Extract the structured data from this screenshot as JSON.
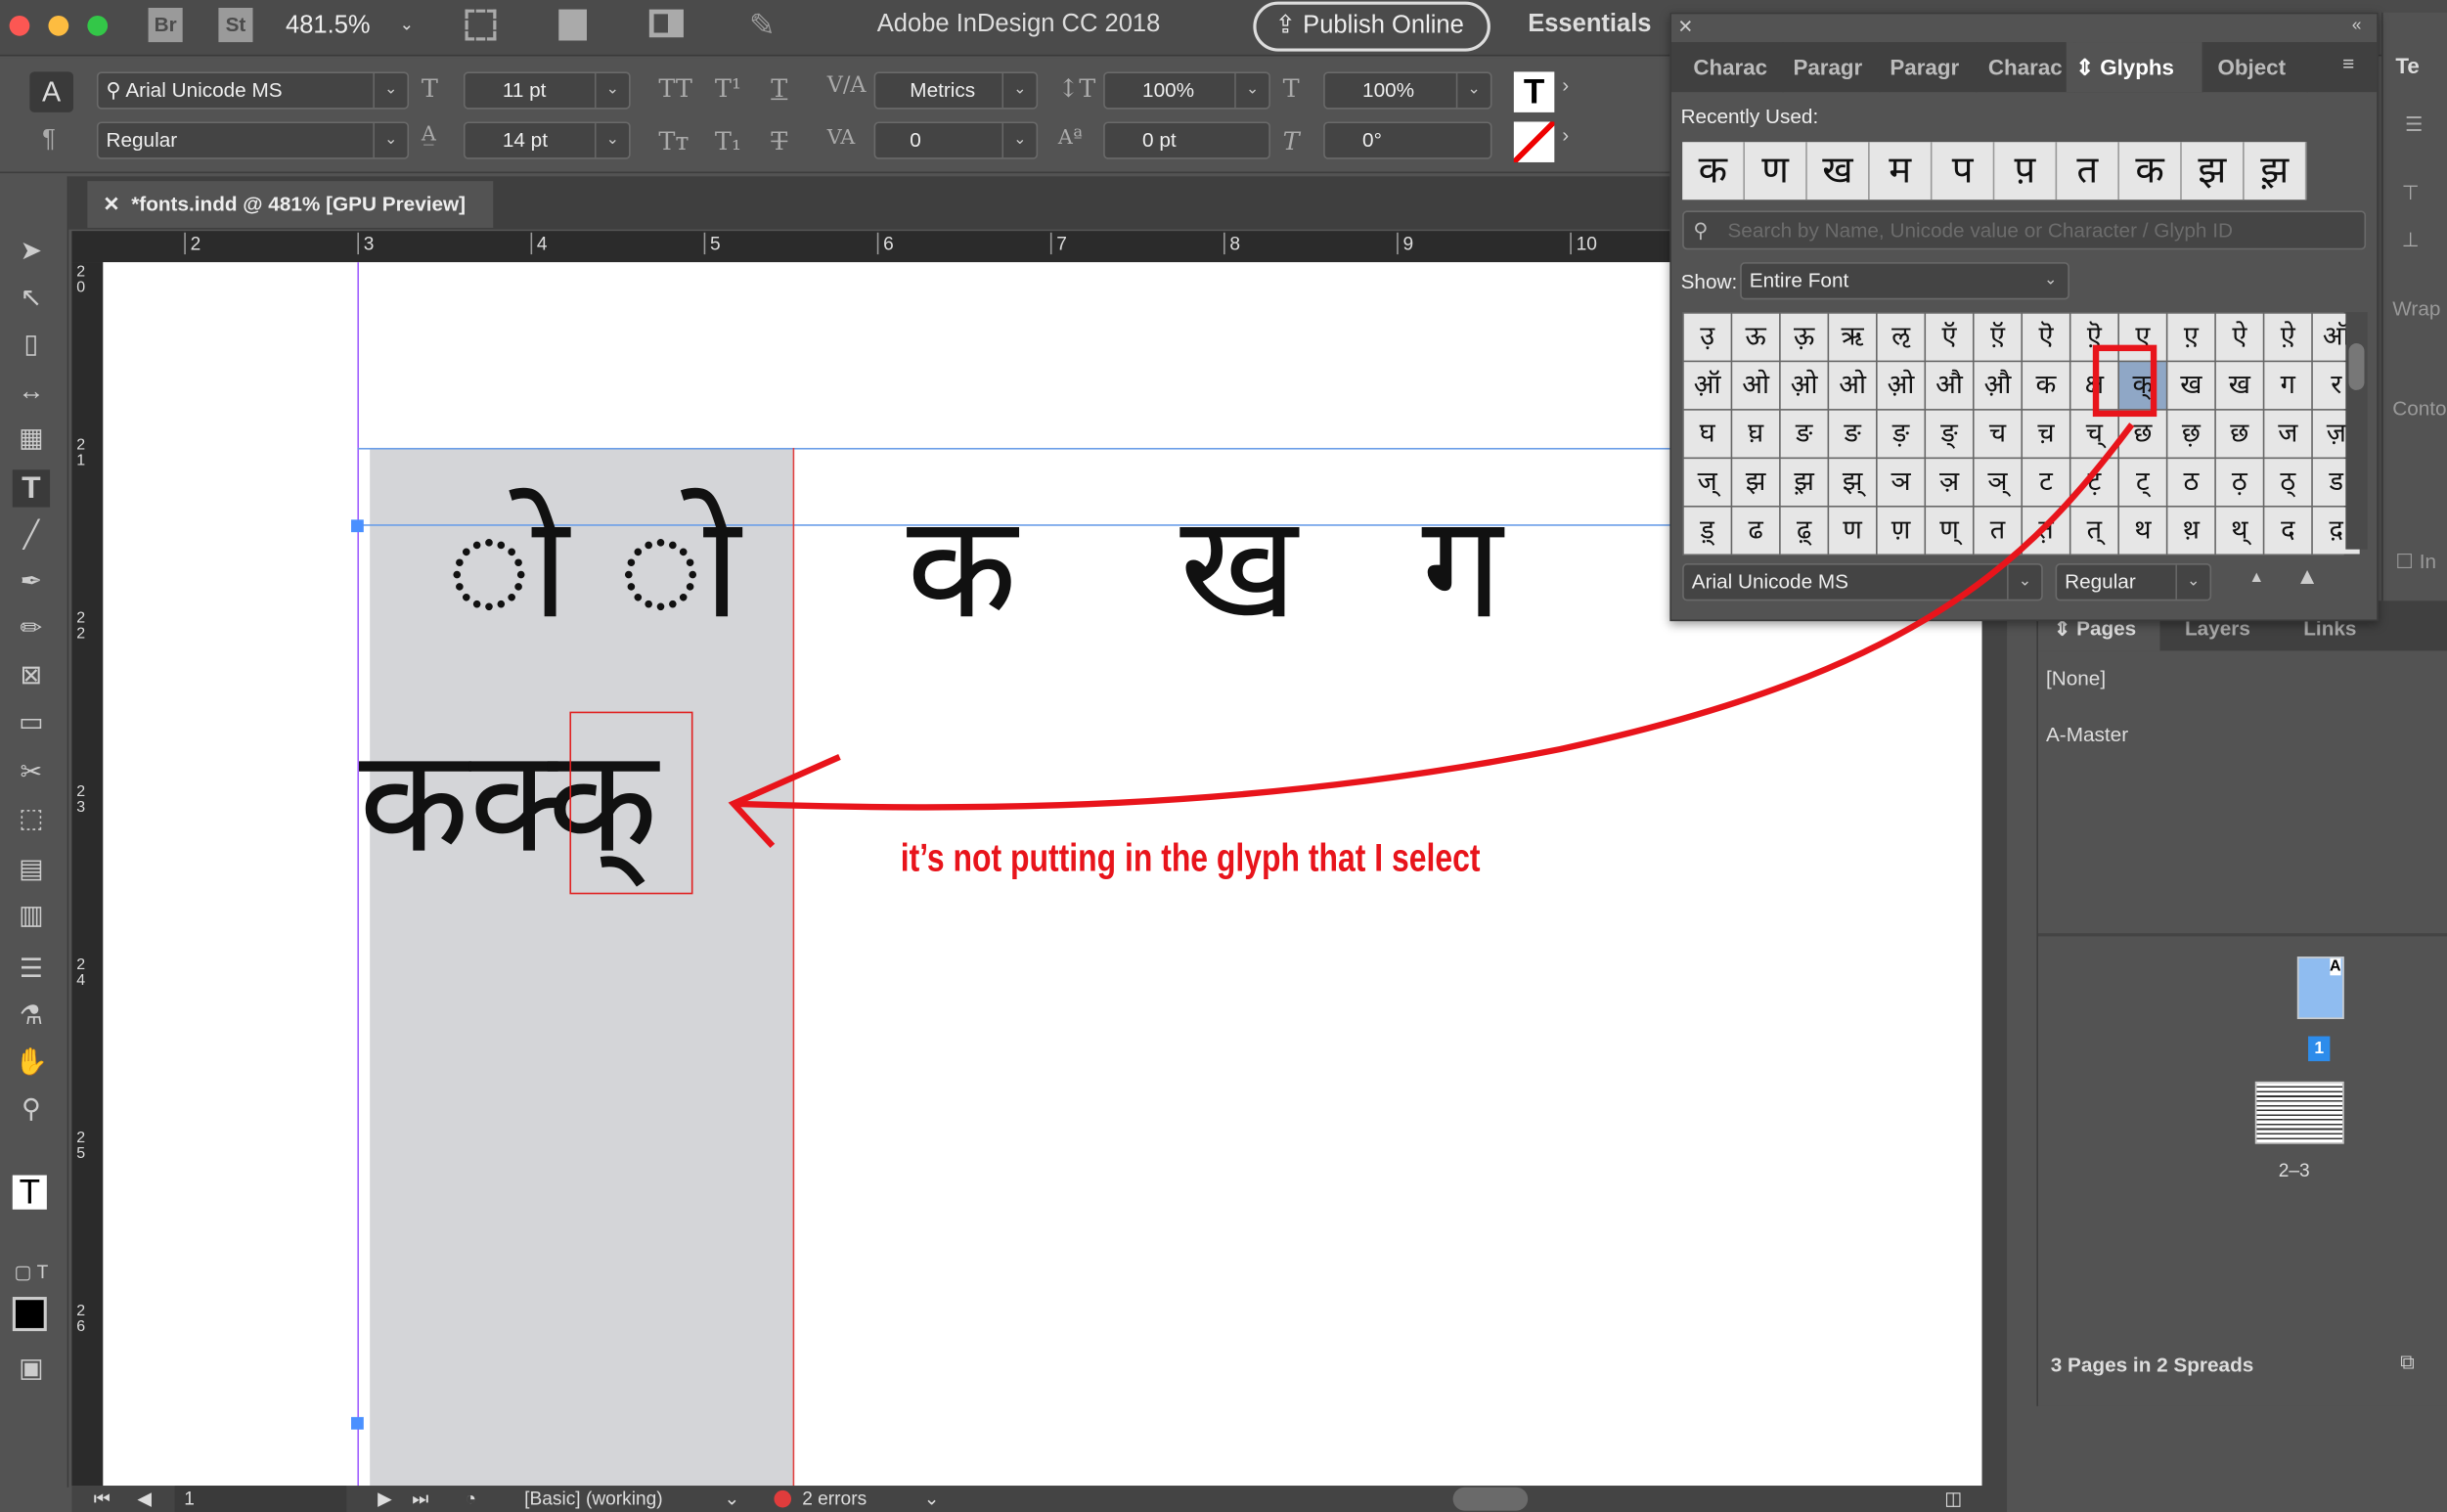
{
  "titlebar": {
    "bridge": "Br",
    "stock": "St",
    "zoom": "481.5%",
    "app_title": "Adobe InDesign CC 2018",
    "publish": "Publish Online",
    "workspace": "Essentials"
  },
  "control": {
    "font": "Arial Unicode MS",
    "style": "Regular",
    "size": "11 pt",
    "leading": "14 pt",
    "kerning": "Metrics",
    "tracking": "0",
    "vscale": "100%",
    "hscale": "100%",
    "baseline": "0 pt",
    "skew": "0°"
  },
  "document_tab": "*fonts.indd @ 481% [GPU Preview]",
  "ruler": {
    "h": [
      "2",
      "3",
      "4",
      "5",
      "6",
      "7",
      "8",
      "9",
      "10"
    ],
    "v": [
      "2\n0",
      "2\n1",
      "2\n2",
      "2\n3",
      "2\n4",
      "2\n5",
      "2\n6"
    ]
  },
  "canvas": {
    "line1": [
      "ो",
      "ो",
      "क",
      "ख",
      "ग"
    ],
    "line2": "कक्क्",
    "annotation": "it’s not putting in the glyph that I select",
    "annotation_color": "#e8141b"
  },
  "glyphs_panel": {
    "tabs": [
      "Charac",
      "Paragr",
      "Paragr",
      "Charac",
      "Glyphs",
      "Object"
    ],
    "active_tab": "Glyphs",
    "recently_used_label": "Recently Used:",
    "recent": [
      "क",
      "ण",
      "ख",
      "म",
      "प",
      "प़",
      "त",
      "क",
      "झ",
      "झ़"
    ],
    "search_placeholder": "Search by Name, Unicode value or Character / Glyph ID",
    "show_label": "Show:",
    "show_value": "Entire Font",
    "grid": [
      "उ़",
      "ऊ",
      "ऊ़",
      "ऋ",
      "ऌ",
      "ऍ",
      "ऍ़",
      "ऎ",
      "ऎ़",
      "ए",
      "ए़",
      "ऐ",
      "ऐ़",
      "ऑ",
      "ऑ़",
      "ओ",
      "ओ़",
      "ओ",
      "ओ़",
      "औ",
      "औ़",
      "क",
      "क्ष",
      "क्",
      "ख",
      "ख",
      "ग",
      "र",
      "घ",
      "घ़",
      "ङ",
      "ङ",
      "ङ़",
      "ङ्",
      "च",
      "च़",
      "च्",
      "छ",
      "छ़",
      "छ",
      "ज",
      "ज़",
      "ज्",
      "झ",
      "झ़",
      "झ्",
      "ञ",
      "ञ़",
      "ञ्",
      "ट",
      "ट़",
      "ट्",
      "ठ",
      "ठ़",
      "ठ्",
      "ड",
      "ड़्",
      "ढ",
      "ढ़्",
      "ण",
      "ण़",
      "ण्",
      "त",
      "त़",
      "त्",
      "थ",
      "थ़",
      "थ्",
      "द",
      "द़"
    ],
    "selected_index": 23,
    "font": "Arial Unicode MS",
    "style": "Regular"
  },
  "dock": {
    "text_wrap": "Te",
    "wrap": "Wrap",
    "contour": "Conto",
    "include": "In"
  },
  "pages_panel": {
    "tabs": [
      "Pages",
      "Layers",
      "Links"
    ],
    "masters": [
      "[None]",
      "A-Master"
    ],
    "page1": "1",
    "spread": "2–3",
    "summary": "3 Pages in 2 Spreads",
    "master_letter": "A"
  },
  "status": {
    "page": "1",
    "profile": "[Basic] (working)",
    "errors": "2 errors",
    "error_color": "#e03c3c"
  }
}
